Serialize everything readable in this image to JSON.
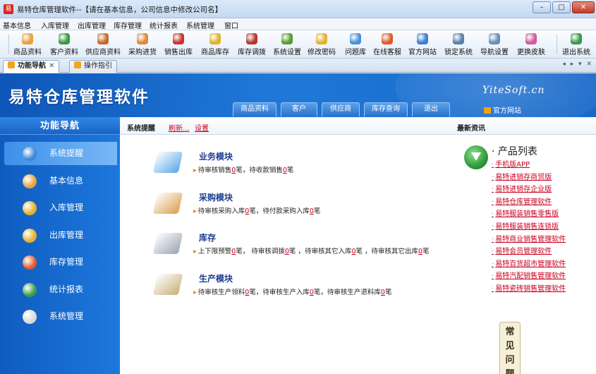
{
  "window": {
    "title": "易特仓库管理软件--【请在基本信息，公司信息中修改公司名】",
    "app_icon_text": "易",
    "controls": {
      "minimize": "–",
      "maximize": "□",
      "close": "✕"
    }
  },
  "menubar": [
    "基本信息",
    "入库管理",
    "出库管理",
    "库存管理",
    "统计报表",
    "系统管理",
    "窗口"
  ],
  "toolbar": [
    {
      "label": "商品资料",
      "icon": "product-icon",
      "color": "#e8a23a"
    },
    {
      "label": "客户资料",
      "icon": "customer-icon",
      "color": "#3c9a40"
    },
    {
      "label": "供应商资料",
      "icon": "supplier-icon",
      "color": "#c76a2c"
    },
    {
      "label": "采购进货",
      "icon": "purchase-icon",
      "color": "#d98a3a"
    },
    {
      "label": "销售出库",
      "icon": "sales-icon",
      "color": "#c9322a"
    },
    {
      "label": "商品库存",
      "icon": "stock-icon",
      "color": "#e3b12a"
    },
    {
      "label": "库存调拨",
      "icon": "transfer-icon",
      "color": "#b8352b"
    },
    {
      "label": "系统设置",
      "icon": "settings-icon",
      "color": "#5a9b2e"
    },
    {
      "label": "修改密码",
      "icon": "password-icon",
      "color": "#e2b230"
    },
    {
      "label": "问题库",
      "icon": "faq-icon",
      "color": "#4a90d9"
    },
    {
      "label": "在线客服",
      "icon": "service-icon",
      "color": "#e05a2a"
    },
    {
      "label": "官方网站",
      "icon": "website-icon",
      "color": "#3a7fd0"
    },
    {
      "label": "锁定系统",
      "icon": "lock-icon",
      "color": "#5a7fa8"
    },
    {
      "label": "导航设置",
      "icon": "nav-settings-icon",
      "color": "#6a8fb8"
    },
    {
      "label": "更换皮肤",
      "icon": "skin-icon",
      "color": "#d05a9a"
    },
    {
      "label": "退出系统",
      "icon": "exit-icon",
      "color": "#3a9a4a"
    }
  ],
  "tabs": {
    "items": [
      {
        "label": "功能导航",
        "active": true,
        "close": "✕"
      },
      {
        "label": "操作指引",
        "active": false
      }
    ],
    "nav_controls": "◂ ▸ ▾ ✕"
  },
  "banner": {
    "app_name": "易特仓库管理软件",
    "brand": "YiteSoft.cn",
    "official_site": "官方网站",
    "nav_buttons": [
      "商品资料",
      "客户",
      "供应商",
      "库存查询",
      "退出"
    ]
  },
  "sidebar": {
    "header": "功能导航",
    "items": [
      {
        "label": "系统提醒",
        "active": true,
        "icon": "info-icon",
        "color": "#3a86d8"
      },
      {
        "label": "基本信息",
        "active": false,
        "icon": "basic-info-icon",
        "color": "#e8a23a"
      },
      {
        "label": "入库管理",
        "active": false,
        "icon": "inbound-icon",
        "color": "#e3b12a"
      },
      {
        "label": "出库管理",
        "active": false,
        "icon": "outbound-icon",
        "color": "#e3b12a"
      },
      {
        "label": "库存管理",
        "active": false,
        "icon": "inventory-icon",
        "color": "#e05a2a"
      },
      {
        "label": "统计报表",
        "active": false,
        "icon": "report-icon",
        "color": "#3a9a4a"
      },
      {
        "label": "系统管理",
        "active": false,
        "icon": "system-icon",
        "color": "#d9d9d9"
      }
    ]
  },
  "main": {
    "crumb_title": "系统提醒",
    "refresh": "刷新...",
    "settings": "设置",
    "news_title": "最新资讯",
    "modules": [
      {
        "title": "业务模块",
        "icon": "business-icon",
        "color": "#5aa8e8",
        "parts": [
          "待审核销售",
          "0",
          "笔，待收款销售",
          "0",
          "笔"
        ]
      },
      {
        "title": "采购模块",
        "icon": "purchase-module-icon",
        "color": "#d9a050",
        "parts": [
          "待审核采购入库",
          "0",
          "笔，待付款采购入库",
          "0",
          "笔"
        ]
      },
      {
        "title": "库存",
        "icon": "stock-module-icon",
        "color": "#9aa6b4",
        "parts": [
          "上下限预警",
          "0",
          "笔，  待审核调拨",
          "0",
          "笔 ，待审核其它入库",
          "0",
          "笔 ，待审核其它出库",
          "0",
          "笔"
        ]
      },
      {
        "title": "生产模块",
        "icon": "production-icon",
        "color": "#c9b27a",
        "parts": [
          "待审核生产领料",
          "0",
          "笔，待审核生产入库",
          "0",
          "笔，待审核生产退料库",
          "0",
          "笔"
        ]
      }
    ],
    "product_list": {
      "title": "产品列表",
      "items": [
        "手机版APP",
        "易特进销存商贸版",
        "易特进销存企业版",
        "易特仓库管理软件",
        "易特服装销售零售版",
        "易特服装销售连锁版",
        "易特商业销售管理软件",
        "易特会员管理软件",
        "易特百货超市管理软件",
        "易特汽配销售管理软件",
        "易特瓷砖销售管理软件"
      ]
    },
    "faq_tab": [
      "常",
      "见",
      "问",
      "题"
    ]
  }
}
